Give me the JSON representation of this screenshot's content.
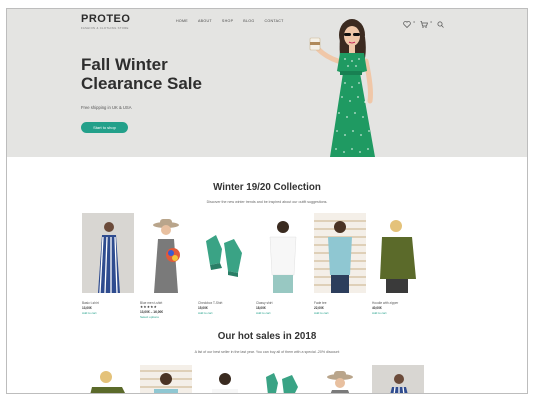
{
  "brand": {
    "name": "PROTEO",
    "tagline": "Fashion & Clothing Store"
  },
  "nav": [
    "HOME",
    "ABOUT",
    "SHOP",
    "BLOG",
    "CONTACT"
  ],
  "header_icons": [
    {
      "icon": "heart-icon",
      "count": "0"
    },
    {
      "icon": "cart-icon",
      "count": "0"
    },
    {
      "icon": "search-icon"
    }
  ],
  "hero": {
    "title_line1": "Fall Winter",
    "title_line2": "Clearance Sale",
    "subtitle": "Free shipping in UK & USA",
    "cta": "Start to shop"
  },
  "collection": {
    "title": "Winter 19/20 Collection",
    "subtitle": "Discover the new winter trends and be inspired about our outfit suggestions.",
    "products": [
      {
        "name": "Basic t-shirt",
        "price": "13,00€",
        "action": "Add to cart"
      },
      {
        "name": "Blue men t-shirt",
        "price": "13,00€ – 16,00€",
        "rating": 5,
        "action": "Select options"
      },
      {
        "name": "Checkbox T-Shirt",
        "price": "15,00€",
        "action": "Add to cart"
      },
      {
        "name": "Classy shirt",
        "price": "18,00€",
        "action": "Add to cart"
      },
      {
        "name": "Fade tee",
        "price": "22,00€",
        "action": "Add to cart"
      },
      {
        "name": "Hoodie with zipper",
        "price": "40,00€",
        "action": "Add to cart"
      }
    ]
  },
  "hot_sales": {
    "title": "Our hot sales in 2018",
    "subtitle": "A list of our best seller in the last year. You can buy all of them with a special -20% discount"
  },
  "colors": {
    "accent": "#23a08a",
    "hero_bg": "#e4e4e2",
    "dress": "#1f9a62"
  }
}
